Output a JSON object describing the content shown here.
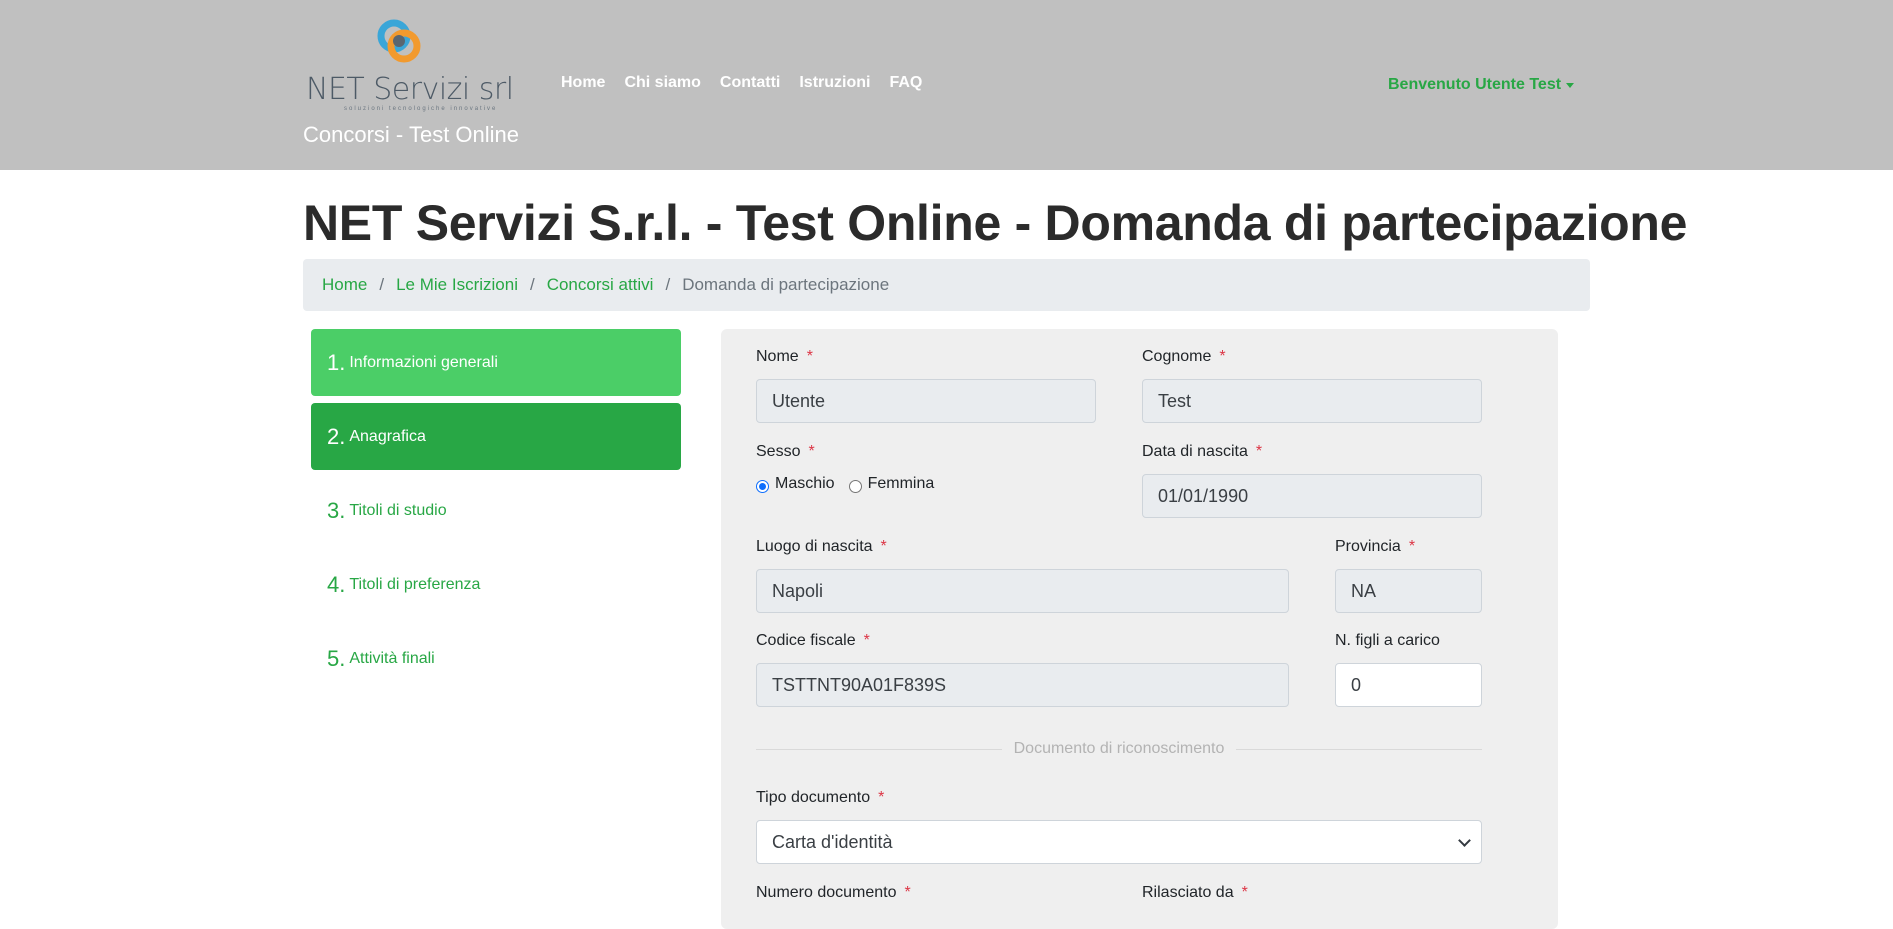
{
  "header": {
    "logo_text": "NET Servizi srl",
    "logo_subtext": "soluzioni tecnologiche innovative",
    "site_subtitle": "Concorsi - Test Online",
    "nav": [
      "Home",
      "Chi siamo",
      "Contatti",
      "Istruzioni",
      "FAQ"
    ],
    "user_menu": "Benvenuto Utente Test"
  },
  "page": {
    "title": "NET Servizi S.r.l. - Test Online - Domanda di partecipazione"
  },
  "breadcrumb": [
    "Home",
    "Le Mie Iscrizioni",
    "Concorsi attivi",
    "Domanda di partecipazione"
  ],
  "steps": [
    {
      "num": "1.",
      "label": "Informazioni generali",
      "state": "done"
    },
    {
      "num": "2.",
      "label": "Anagrafica",
      "state": "active"
    },
    {
      "num": "3.",
      "label": "Titoli di studio",
      "state": "pending"
    },
    {
      "num": "4.",
      "label": "Titoli di preferenza",
      "state": "pending"
    },
    {
      "num": "5.",
      "label": "Attività finali",
      "state": "pending"
    }
  ],
  "form": {
    "nome": {
      "label": "Nome",
      "value": "Utente"
    },
    "cognome": {
      "label": "Cognome",
      "value": "Test"
    },
    "sesso": {
      "label": "Sesso",
      "options": [
        "Maschio",
        "Femmina"
      ],
      "selected": "Maschio"
    },
    "data_nascita": {
      "label": "Data di nascita",
      "value": "01/01/1990"
    },
    "luogo_nascita": {
      "label": "Luogo di nascita",
      "value": "Napoli"
    },
    "provincia": {
      "label": "Provincia",
      "value": "NA"
    },
    "codice_fiscale": {
      "label": "Codice fiscale",
      "value": "TSTTNT90A01F839S"
    },
    "figli": {
      "label": "N. figli a carico",
      "value": "0"
    },
    "section_documento": "Documento di riconoscimento",
    "tipo_documento": {
      "label": "Tipo documento",
      "value": "Carta d'identità"
    },
    "numero_documento": {
      "label": "Numero documento"
    },
    "rilasciato_da": {
      "label": "Rilasciato da"
    },
    "required_mark": "*"
  },
  "colors": {
    "accent": "#28a745",
    "step_done": "#4bce67",
    "header_bg": "#c0c0c0"
  }
}
